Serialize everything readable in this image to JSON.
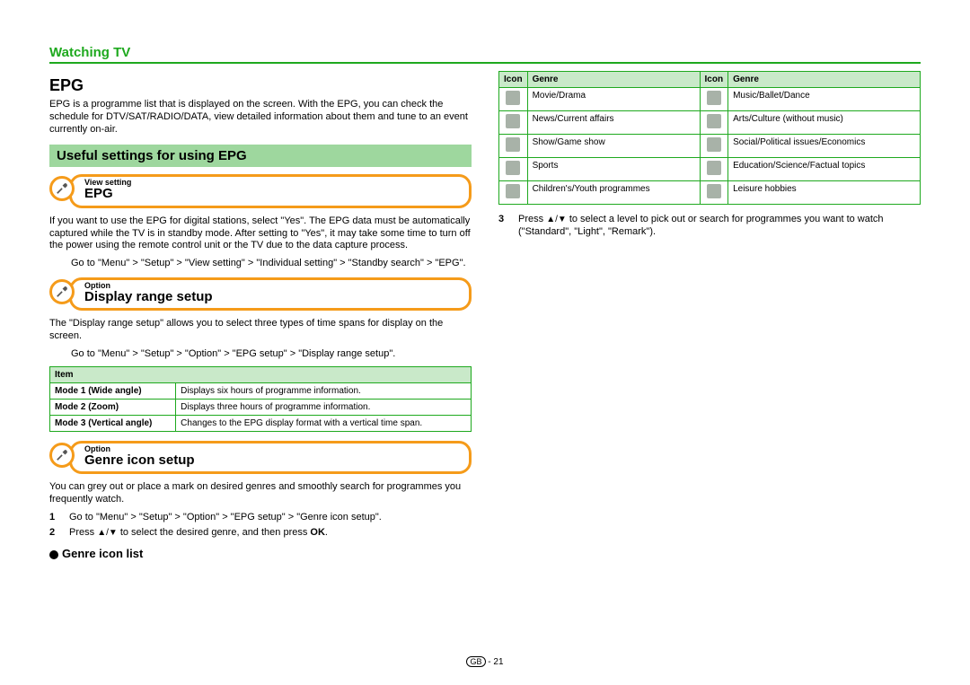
{
  "page_header": "Watching TV",
  "main_title": "EPG",
  "intro_para": "EPG is a programme list that is displayed on the screen. With the EPG, you can check the schedule for DTV/SAT/RADIO/DATA, view detailed information about them and tune to an event currently on-air.",
  "useful_bar": "Useful settings for using EPG",
  "pill_epg": {
    "super": "View setting",
    "title": "EPG"
  },
  "epg_para": "If you want to use the EPG for digital stations, select \"Yes\". The EPG data must be automatically captured while the TV is in standby mode. After setting to \"Yes\", it may take some time to turn off the power using the remote control unit or the TV due to the data capture process.",
  "epg_path": "Go to \"Menu\" > \"Setup\" > \"View setting\" > \"Individual setting\" > \"Standby search\" > \"EPG\".",
  "pill_display": {
    "super": "Option",
    "title": "Display range setup"
  },
  "display_para": "The \"Display range setup\" allows you to select three types of time spans for display on the screen.",
  "display_path": "Go to \"Menu\" > \"Setup\" > \"Option\" > \"EPG setup\" > \"Display range setup\".",
  "mode_table": {
    "header": "Item",
    "rows": [
      {
        "k": "Mode 1 (Wide angle)",
        "v": "Displays six hours of programme information."
      },
      {
        "k": "Mode 2 (Zoom)",
        "v": "Displays three hours of programme information."
      },
      {
        "k": "Mode 3 (Vertical angle)",
        "v": "Changes to the EPG display format with a vertical time span."
      }
    ]
  },
  "pill_genre": {
    "super": "Option",
    "title": "Genre icon setup"
  },
  "genre_para": "You can grey out or place a mark on desired genres and smoothly search for programmes you frequently watch.",
  "genre_steps": {
    "s1": "Go to \"Menu\" > \"Setup\" > \"Option\" > \"EPG setup\" > \"Genre icon setup\".",
    "s2a": "Press ",
    "s2b": " to select the desired genre, and then press ",
    "s2c": "OK",
    "s2d": ".",
    "s3a": "Press ",
    "s3b": " to select a level to pick out or search for programmes you want to watch (\"Standard\", \"Light\", \"Remark\")."
  },
  "genre_heading": "Genre icon list",
  "genre_table": {
    "headers": [
      "Icon",
      "Genre",
      "Icon",
      "Genre"
    ],
    "rows": [
      [
        "Movie/Drama",
        "Music/Ballet/Dance"
      ],
      [
        "News/Current affairs",
        "Arts/Culture (without music)"
      ],
      [
        "Show/Game show",
        "Social/Political issues/Economics"
      ],
      [
        "Sports",
        "Education/Science/Factual topics"
      ],
      [
        "Children's/Youth programmes",
        "Leisure hobbies"
      ]
    ]
  },
  "footer_region": "GB",
  "footer_page": "21"
}
